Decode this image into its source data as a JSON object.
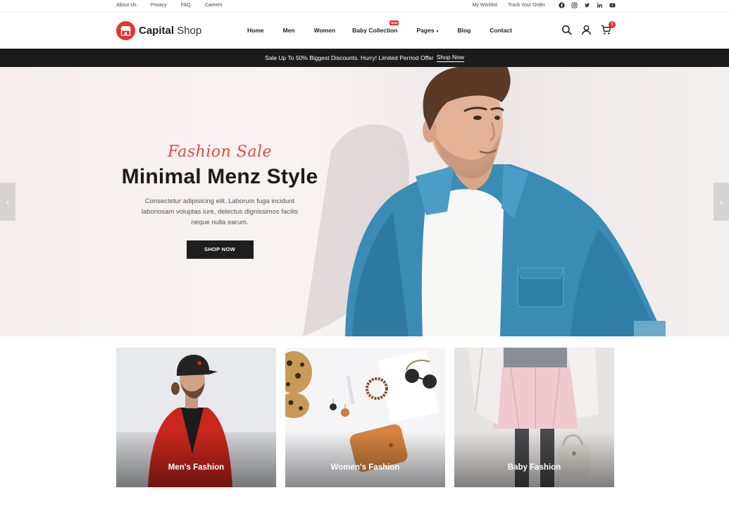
{
  "topbar": {
    "links": [
      "About Us",
      "Privacy",
      "FAQ",
      "Careers"
    ],
    "wishlist": "My Wishlist",
    "track_order": "Track Your Order",
    "socials": [
      "facebook-icon",
      "instagram-icon",
      "twitter-icon",
      "linkedin-icon",
      "youtube-icon"
    ]
  },
  "header": {
    "logo_bold": "Capital",
    "logo_light": "Shop",
    "nav": [
      "Home",
      "Men",
      "Women",
      "Baby Collection",
      "Pages",
      "Blog",
      "Contact"
    ],
    "new_badge": "New",
    "cart_count": "1",
    "icons": [
      "search-icon",
      "user-icon",
      "cart-icon"
    ]
  },
  "promo": {
    "text": "Sale Up To 50% Biggest Discounts. Hurry! Limited Perriod Offer",
    "link": "Shop Now"
  },
  "hero": {
    "subtitle": "Fashion Sale",
    "title": "Minimal Menz Style",
    "text": "Consectetur adipisicing elit. Laborum fuga incidunt laboriosam voluptas iure, delectus dignissimos facilis neque nulla earum.",
    "button": "SHOP NOW"
  },
  "categories": [
    {
      "label": "Men's Fashion"
    },
    {
      "label": "Women's Fashion"
    },
    {
      "label": "Baby Fashion"
    }
  ],
  "colors": {
    "accent": "#e8322c",
    "dark": "#1b1b1b",
    "hero_bg": "#f6eeee",
    "denim": "#3a8cb5"
  }
}
